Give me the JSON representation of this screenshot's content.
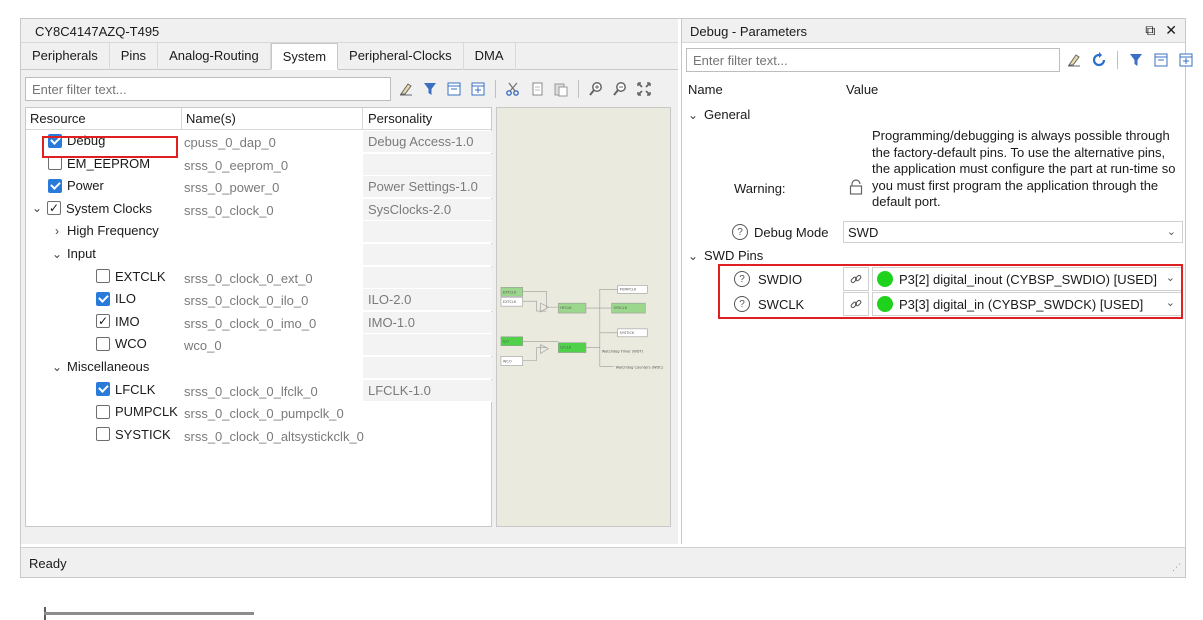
{
  "left_pane": {
    "title": "CY8C4147AZQ-T495",
    "tabs": [
      {
        "label": "Peripherals",
        "active": false
      },
      {
        "label": "Pins",
        "active": false
      },
      {
        "label": "Analog-Routing",
        "active": false
      },
      {
        "label": "System",
        "active": true
      },
      {
        "label": "Peripheral-Clocks",
        "active": false
      },
      {
        "label": "DMA",
        "active": false
      }
    ],
    "filter_placeholder": "Enter filter text...",
    "columns": {
      "resource": "Resource",
      "name": "Name(s)",
      "personality": "Personality"
    },
    "rows": [
      {
        "label": "Debug",
        "check": "checked",
        "name": "cpuss_0_dap_0",
        "personality": "Debug Access-1.0"
      },
      {
        "label": "EM_EEPROM",
        "check": "unchecked",
        "name": "srss_0_eeprom_0",
        "personality": ""
      },
      {
        "label": "Power",
        "check": "checked",
        "name": "srss_0_power_0",
        "personality": "Power Settings-1.0"
      },
      {
        "label": "System Clocks",
        "check": "partial",
        "name": "srss_0_clock_0",
        "personality": "SysClocks-2.0"
      },
      {
        "label": "High Frequency",
        "name": "",
        "personality": ""
      },
      {
        "label": "Input",
        "name": "",
        "personality": ""
      },
      {
        "label": "EXTCLK",
        "check": "unchecked",
        "name": "srss_0_clock_0_ext_0",
        "personality": ""
      },
      {
        "label": "ILO",
        "check": "checked",
        "name": "srss_0_clock_0_ilo_0",
        "personality": "ILO-2.0"
      },
      {
        "label": "IMO",
        "check": "partial",
        "name": "srss_0_clock_0_imo_0",
        "personality": "IMO-1.0"
      },
      {
        "label": "WCO",
        "check": "unchecked",
        "name": "wco_0",
        "personality": ""
      },
      {
        "label": "Miscellaneous",
        "name": "",
        "personality": ""
      },
      {
        "label": "LFCLK",
        "check": "checked",
        "name": "srss_0_clock_0_lfclk_0",
        "personality": "LFCLK-1.0"
      },
      {
        "label": "PUMPCLK",
        "check": "unchecked",
        "name": "srss_0_clock_0_pumpclk_0",
        "personality": ""
      },
      {
        "label": "SYSTICK",
        "check": "unchecked",
        "name": "srss_0_clock_0_altsystickclk_0",
        "personality": ""
      }
    ]
  },
  "status": {
    "text": "Ready"
  },
  "right_pane": {
    "title": "Debug - Parameters",
    "filter_placeholder": "Enter filter text...",
    "columns": {
      "name": "Name",
      "value": "Value"
    },
    "general_label": "General",
    "warning_label": "Warning:",
    "warning_text": "Programming/debugging is always possible through the factory-default pins. To use the alternative pins, the application must configure the part at run-time so you must first program the application through the default port.",
    "debug_mode_label": "Debug Mode",
    "debug_mode_value": "SWD",
    "swd_pins_label": "SWD Pins",
    "pins": [
      {
        "label": "SWDIO",
        "value": "P3[2] digital_inout (CYBSP_SWDIO) [USED]"
      },
      {
        "label": "SWCLK",
        "value": "P3[3] digital_in (CYBSP_SWDCK) [USED]"
      }
    ]
  },
  "colors": {
    "highlight": "#e02020",
    "checkbox": "#2a7bd9",
    "pin_status": "#1ed21e"
  }
}
